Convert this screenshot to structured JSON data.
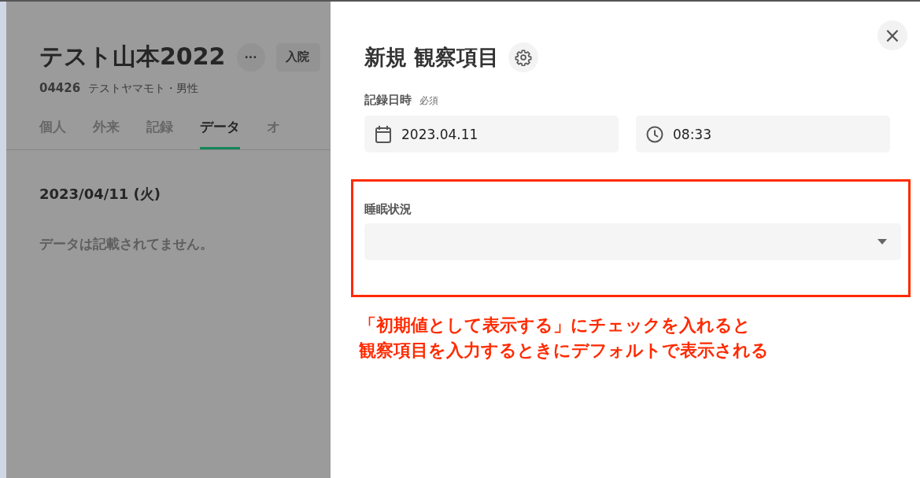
{
  "patient": {
    "name": "テスト山本2022",
    "more_button": "···",
    "admit_button": "入院",
    "id": "04426",
    "kana_sex": "テストヤマモト・男性"
  },
  "tabs": [
    {
      "label": "個人",
      "selected": false
    },
    {
      "label": "外来",
      "selected": false
    },
    {
      "label": "記録",
      "selected": false
    },
    {
      "label": "データ",
      "selected": true
    },
    {
      "label": "オ",
      "selected": false
    }
  ],
  "day": {
    "date": "2023/04/11 (火)",
    "empty_message": "データは記載されてません。"
  },
  "panel": {
    "close": "×",
    "title": "新規 観察項目",
    "record_label": "記録日時",
    "required": "必須",
    "date": "2023.04.11",
    "time": "08:33",
    "sleep_label": "睡眠状況"
  },
  "annotation": [
    "「初期値として表示する」にチェックを入れると",
    "観察項目を入力するときにデフォルトで表示される"
  ]
}
